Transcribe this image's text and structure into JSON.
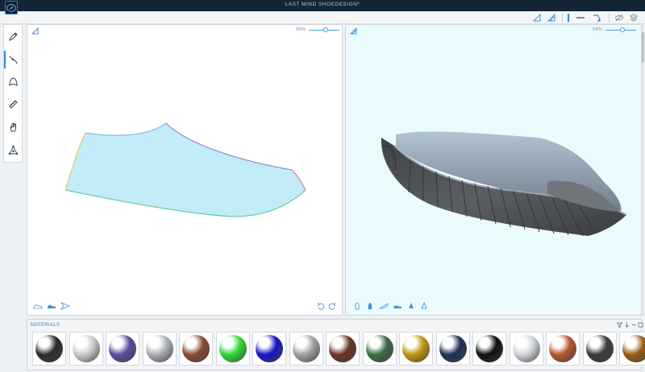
{
  "app": {
    "title": "LAST MIND SHOEDESIGN*"
  },
  "toolbar": {
    "icons": [
      "flat-pattern-icon",
      "surface-pattern-icon",
      "blue-marker-icon",
      "line-tool-icon",
      "flip-tool-icon",
      "visibility-icon",
      "layers-icon"
    ]
  },
  "sidebar": {
    "tools": [
      "pen-icon",
      "curve-tool-icon",
      "shape-icon",
      "ruler-icon",
      "hand-icon",
      "node-tool-icon"
    ],
    "active": "curve-tool-icon"
  },
  "panels": {
    "left": {
      "zoom": "56%",
      "zoom_level": 0.56
    },
    "right": {
      "zoom": "54%",
      "zoom_level": 0.54
    }
  },
  "materials": {
    "title": "MATERIALS",
    "items": [
      {
        "name": "black-matte",
        "color": "#2b2b2b"
      },
      {
        "name": "white-rubber",
        "color": "#c7c9cc"
      },
      {
        "name": "purple-gold-print",
        "color": "#5b4aa0"
      },
      {
        "name": "chrome-silver",
        "color": "#a9aeb4"
      },
      {
        "name": "brown-leather",
        "color": "#8a4a34"
      },
      {
        "name": "green-mesh",
        "color": "#2fd838"
      },
      {
        "name": "royal-blue",
        "color": "#1515c8"
      },
      {
        "name": "grey-knit",
        "color": "#9ea0a3"
      },
      {
        "name": "copper-brown",
        "color": "#6a3424"
      },
      {
        "name": "leopard-print",
        "color": "#3a6a45"
      },
      {
        "name": "gold-metal",
        "color": "#c0940f"
      },
      {
        "name": "navy-suede",
        "color": "#1c3157"
      },
      {
        "name": "black-carbon",
        "color": "#0e0e10"
      },
      {
        "name": "pearl-white",
        "color": "#cfd3d8"
      },
      {
        "name": "orange-leather",
        "color": "#b5562a"
      },
      {
        "name": "dark-weave",
        "color": "#3a3a3c"
      },
      {
        "name": "tortoise-shell",
        "color": "#9a5a12"
      }
    ]
  },
  "colors": {
    "accent": "#2a8be0",
    "titlebar": "#152536",
    "pattern_fill": "#c2ecf8",
    "shoe_upper": "#8d9aa8",
    "shoe_sole": "#4e5157"
  }
}
